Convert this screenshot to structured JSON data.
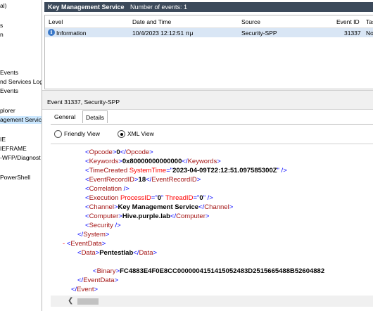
{
  "left_tree": [
    {
      "text": "al)",
      "selected": false
    },
    {
      "text": "s",
      "selected": false
    },
    {
      "text": "n",
      "selected": false
    },
    {
      "text": "Events",
      "selected": false
    },
    {
      "text": "nd Services Log",
      "selected": false
    },
    {
      "text": "Events",
      "selected": false
    },
    {
      "text": "plorer",
      "selected": false
    },
    {
      "text": "agement Service",
      "selected": true
    },
    {
      "text": "IE",
      "selected": false
    },
    {
      "text": "IEFRAME",
      "selected": false
    },
    {
      "text": "-WFP/Diagnost",
      "selected": false
    },
    {
      "text": "PowerShell",
      "selected": false
    }
  ],
  "events_panel": {
    "title": "Key Management Service",
    "count": "Number of events: 1"
  },
  "grid": {
    "columns": [
      "Level",
      "Date and Time",
      "Source",
      "Event ID",
      "Tas"
    ],
    "rows": [
      {
        "level": "Information",
        "date": "10/4/2023 12:12:51 πμ",
        "source": "Security-SPP",
        "event_id": "31337",
        "task": "No"
      }
    ]
  },
  "detail": {
    "title": "Event 31337, Security-SPP",
    "tabs": [
      "General",
      "Details"
    ],
    "active_tab": "Details",
    "views": {
      "friendly": "Friendly View",
      "xml": "XML View",
      "selected": "xml"
    }
  },
  "xml": {
    "opcode_value": "0",
    "keywords_value": "0x80000000000000",
    "time_value": "2023-04-09T22:12:51.097585300Z",
    "record_value": "18",
    "process_id": "0",
    "thread_id": "0",
    "channel_value": "Key Management Service",
    "computer_value": "Hive.purple.lab",
    "data_value": "Pentestlab",
    "binary_value": "FC4883E4F0E8CC0000004151415052483D2515665488B52604882"
  },
  "icons": {
    "info": "info-icon",
    "scroll_left": "chevron-left-icon"
  },
  "colors": {
    "header_bg": "#3c4a5b",
    "selected_row": "#d9e6f5",
    "xml_tag": "#a31515",
    "xml_bracket": "#0000ff"
  }
}
